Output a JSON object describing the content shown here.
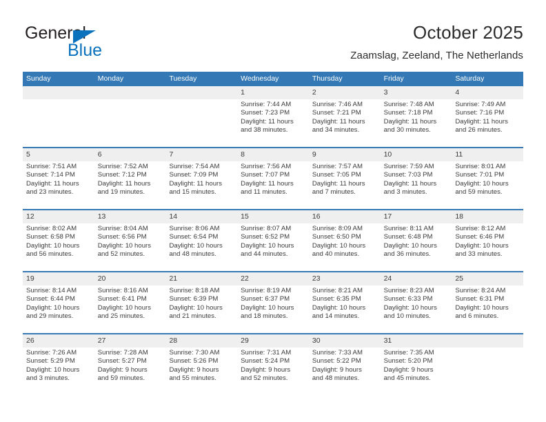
{
  "brand": {
    "name_part1": "General",
    "name_part2": "Blue",
    "color_dark": "#231f20",
    "color_blue": "#0a71bc"
  },
  "header": {
    "title": "October 2025",
    "subtitle": "Zaamslag, Zeeland, The Netherlands"
  },
  "theme": {
    "header_blue": "#3479b5",
    "num_band": "#efeff0",
    "text": "#3a3a3a"
  },
  "weekdays": [
    "Sunday",
    "Monday",
    "Tuesday",
    "Wednesday",
    "Thursday",
    "Friday",
    "Saturday"
  ],
  "weeks": [
    [
      {
        "day": "",
        "l1": "",
        "l2": "",
        "l3": "",
        "l4": ""
      },
      {
        "day": "",
        "l1": "",
        "l2": "",
        "l3": "",
        "l4": ""
      },
      {
        "day": "",
        "l1": "",
        "l2": "",
        "l3": "",
        "l4": ""
      },
      {
        "day": "1",
        "l1": "Sunrise: 7:44 AM",
        "l2": "Sunset: 7:23 PM",
        "l3": "Daylight: 11 hours",
        "l4": "and 38 minutes."
      },
      {
        "day": "2",
        "l1": "Sunrise: 7:46 AM",
        "l2": "Sunset: 7:21 PM",
        "l3": "Daylight: 11 hours",
        "l4": "and 34 minutes."
      },
      {
        "day": "3",
        "l1": "Sunrise: 7:48 AM",
        "l2": "Sunset: 7:18 PM",
        "l3": "Daylight: 11 hours",
        "l4": "and 30 minutes."
      },
      {
        "day": "4",
        "l1": "Sunrise: 7:49 AM",
        "l2": "Sunset: 7:16 PM",
        "l3": "Daylight: 11 hours",
        "l4": "and 26 minutes."
      }
    ],
    [
      {
        "day": "5",
        "l1": "Sunrise: 7:51 AM",
        "l2": "Sunset: 7:14 PM",
        "l3": "Daylight: 11 hours",
        "l4": "and 23 minutes."
      },
      {
        "day": "6",
        "l1": "Sunrise: 7:52 AM",
        "l2": "Sunset: 7:12 PM",
        "l3": "Daylight: 11 hours",
        "l4": "and 19 minutes."
      },
      {
        "day": "7",
        "l1": "Sunrise: 7:54 AM",
        "l2": "Sunset: 7:09 PM",
        "l3": "Daylight: 11 hours",
        "l4": "and 15 minutes."
      },
      {
        "day": "8",
        "l1": "Sunrise: 7:56 AM",
        "l2": "Sunset: 7:07 PM",
        "l3": "Daylight: 11 hours",
        "l4": "and 11 minutes."
      },
      {
        "day": "9",
        "l1": "Sunrise: 7:57 AM",
        "l2": "Sunset: 7:05 PM",
        "l3": "Daylight: 11 hours",
        "l4": "and 7 minutes."
      },
      {
        "day": "10",
        "l1": "Sunrise: 7:59 AM",
        "l2": "Sunset: 7:03 PM",
        "l3": "Daylight: 11 hours",
        "l4": "and 3 minutes."
      },
      {
        "day": "11",
        "l1": "Sunrise: 8:01 AM",
        "l2": "Sunset: 7:01 PM",
        "l3": "Daylight: 10 hours",
        "l4": "and 59 minutes."
      }
    ],
    [
      {
        "day": "12",
        "l1": "Sunrise: 8:02 AM",
        "l2": "Sunset: 6:58 PM",
        "l3": "Daylight: 10 hours",
        "l4": "and 56 minutes."
      },
      {
        "day": "13",
        "l1": "Sunrise: 8:04 AM",
        "l2": "Sunset: 6:56 PM",
        "l3": "Daylight: 10 hours",
        "l4": "and 52 minutes."
      },
      {
        "day": "14",
        "l1": "Sunrise: 8:06 AM",
        "l2": "Sunset: 6:54 PM",
        "l3": "Daylight: 10 hours",
        "l4": "and 48 minutes."
      },
      {
        "day": "15",
        "l1": "Sunrise: 8:07 AM",
        "l2": "Sunset: 6:52 PM",
        "l3": "Daylight: 10 hours",
        "l4": "and 44 minutes."
      },
      {
        "day": "16",
        "l1": "Sunrise: 8:09 AM",
        "l2": "Sunset: 6:50 PM",
        "l3": "Daylight: 10 hours",
        "l4": "and 40 minutes."
      },
      {
        "day": "17",
        "l1": "Sunrise: 8:11 AM",
        "l2": "Sunset: 6:48 PM",
        "l3": "Daylight: 10 hours",
        "l4": "and 36 minutes."
      },
      {
        "day": "18",
        "l1": "Sunrise: 8:12 AM",
        "l2": "Sunset: 6:46 PM",
        "l3": "Daylight: 10 hours",
        "l4": "and 33 minutes."
      }
    ],
    [
      {
        "day": "19",
        "l1": "Sunrise: 8:14 AM",
        "l2": "Sunset: 6:44 PM",
        "l3": "Daylight: 10 hours",
        "l4": "and 29 minutes."
      },
      {
        "day": "20",
        "l1": "Sunrise: 8:16 AM",
        "l2": "Sunset: 6:41 PM",
        "l3": "Daylight: 10 hours",
        "l4": "and 25 minutes."
      },
      {
        "day": "21",
        "l1": "Sunrise: 8:18 AM",
        "l2": "Sunset: 6:39 PM",
        "l3": "Daylight: 10 hours",
        "l4": "and 21 minutes."
      },
      {
        "day": "22",
        "l1": "Sunrise: 8:19 AM",
        "l2": "Sunset: 6:37 PM",
        "l3": "Daylight: 10 hours",
        "l4": "and 18 minutes."
      },
      {
        "day": "23",
        "l1": "Sunrise: 8:21 AM",
        "l2": "Sunset: 6:35 PM",
        "l3": "Daylight: 10 hours",
        "l4": "and 14 minutes."
      },
      {
        "day": "24",
        "l1": "Sunrise: 8:23 AM",
        "l2": "Sunset: 6:33 PM",
        "l3": "Daylight: 10 hours",
        "l4": "and 10 minutes."
      },
      {
        "day": "25",
        "l1": "Sunrise: 8:24 AM",
        "l2": "Sunset: 6:31 PM",
        "l3": "Daylight: 10 hours",
        "l4": "and 6 minutes."
      }
    ],
    [
      {
        "day": "26",
        "l1": "Sunrise: 7:26 AM",
        "l2": "Sunset: 5:29 PM",
        "l3": "Daylight: 10 hours",
        "l4": "and 3 minutes."
      },
      {
        "day": "27",
        "l1": "Sunrise: 7:28 AM",
        "l2": "Sunset: 5:27 PM",
        "l3": "Daylight: 9 hours",
        "l4": "and 59 minutes."
      },
      {
        "day": "28",
        "l1": "Sunrise: 7:30 AM",
        "l2": "Sunset: 5:26 PM",
        "l3": "Daylight: 9 hours",
        "l4": "and 55 minutes."
      },
      {
        "day": "29",
        "l1": "Sunrise: 7:31 AM",
        "l2": "Sunset: 5:24 PM",
        "l3": "Daylight: 9 hours",
        "l4": "and 52 minutes."
      },
      {
        "day": "30",
        "l1": "Sunrise: 7:33 AM",
        "l2": "Sunset: 5:22 PM",
        "l3": "Daylight: 9 hours",
        "l4": "and 48 minutes."
      },
      {
        "day": "31",
        "l1": "Sunrise: 7:35 AM",
        "l2": "Sunset: 5:20 PM",
        "l3": "Daylight: 9 hours",
        "l4": "and 45 minutes."
      },
      {
        "day": "",
        "l1": "",
        "l2": "",
        "l3": "",
        "l4": ""
      }
    ]
  ]
}
